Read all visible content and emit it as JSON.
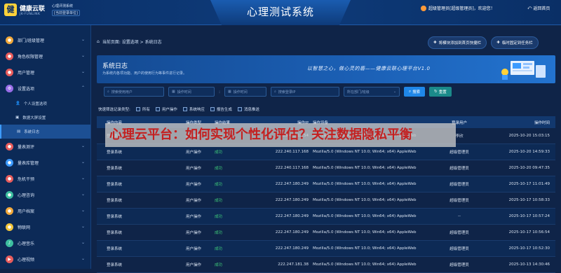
{
  "header": {
    "logo_mark": "健",
    "logo_cn": "健康云联",
    "logo_en": "JK-YUNLINK",
    "system_name": "心理评测系统",
    "unit_label": "[当前登录单位]",
    "app_title": "心理测试系统",
    "user_text": "超级管理员[超级管理员]，欢迎您！",
    "back_label": "返回首页"
  },
  "sidebar": {
    "items": [
      {
        "label": "部门/班级管理",
        "icon": "org-icon",
        "color": "#f2a93b"
      },
      {
        "label": "角色权限管理",
        "icon": "role-icon",
        "color": "#e85c5c"
      },
      {
        "label": "用户管理",
        "icon": "user-icon",
        "color": "#e85c5c"
      },
      {
        "label": "设置选项",
        "icon": "settings-icon",
        "color": "#9a6ee8"
      }
    ],
    "sub_items": [
      {
        "label": "个人设置选项"
      },
      {
        "label": "数据大屏设置"
      },
      {
        "label": "系统日志"
      }
    ],
    "more_items": [
      {
        "label": "量表测评",
        "icon": "test-icon",
        "color": "#e85c5c"
      },
      {
        "label": "量表库管理",
        "icon": "library-icon",
        "color": "#3d9bff"
      },
      {
        "label": "危机干预",
        "icon": "crisis-icon",
        "color": "#e85c5c"
      },
      {
        "label": "心理咨询",
        "icon": "consult-icon",
        "color": "#3dbfa0"
      },
      {
        "label": "用户档案",
        "icon": "archive-icon",
        "color": "#f2a93b"
      },
      {
        "label": "物联网",
        "icon": "iot-icon",
        "color": "#f2c53b"
      },
      {
        "label": "心理音乐",
        "icon": "music-icon",
        "color": "#3dbfa0"
      },
      {
        "label": "心理视频",
        "icon": "video-icon",
        "color": "#e85c5c"
      }
    ]
  },
  "breadcrumb": "当前页面: 设置选项 > 系统日志",
  "tools": {
    "add_shortcut": "将模块添加到首页快捷栏",
    "pin_sidebar": "临时固定到任务栏"
  },
  "banner": {
    "title": "系统日志",
    "desc": "为系统内各项功能、用户的使用行为等事件进行记录。",
    "slogan": "以智慧之心，做心灵的盾——健康云联心理平台V1.0"
  },
  "filters": {
    "user_placeholder": "搜索使用用户",
    "start_placeholder": "操作时间",
    "end_placeholder": "操作时间",
    "ip_placeholder": "搜索登录IP",
    "dept_placeholder": "所在部门/班级",
    "search_label": "搜索",
    "reset_label": "重置"
  },
  "quick": {
    "label": "快速筛选记录类型:",
    "options": [
      "所有",
      "用户操作",
      "系统响应",
      "报告生成",
      "消息推送"
    ]
  },
  "table": {
    "headers": [
      "操作内容",
      "操作类型",
      "操作结果",
      "操作IP",
      "操作设备",
      "",
      "登录用户",
      "操作时间"
    ],
    "rows": [
      [
        "登录系统",
        "用户操作",
        "成功",
        "123.4.101.154",
        "Mozilla/5.0 (Windows NT 10.0; Win64; x64) AppleWebKit/537.36 (KHTML, like Gec...",
        "",
        "李欣",
        "2025-10-20 15:03:15"
      ],
      [
        "登录系统",
        "用户操作",
        "成功",
        "222.240.117.168",
        "Mozilla/5.0 (Windows NT 10.0; Win64; x64) AppleWebKit/537.36 (KHTML, like Gec...",
        "",
        "超级管理员",
        "2025-10-20 14:59:33"
      ],
      [
        "登录系统",
        "用户操作",
        "成功",
        "222.240.117.168",
        "Mozilla/5.0 (Windows NT 10.0; Win64; x64) AppleWebKit/537.36 (KHTML, like Gec...",
        "",
        "超级管理员",
        "2025-10-20 09:47:35"
      ],
      [
        "登录系统",
        "用户操作",
        "成功",
        "222.247.180.249",
        "Mozilla/5.0 (Windows NT 10.0; Win64; x64) AppleWebKit/537.36 (KHTML, like Gec...",
        "",
        "超级管理员",
        "2025-10-17 11:01:49"
      ],
      [
        "登录系统",
        "用户操作",
        "成功",
        "222.247.180.249",
        "Mozilla/5.0 (Windows NT 10.0; Win64; x64) AppleWebKit/537.36 (KHTML, like Gec...",
        "",
        "超级管理员",
        "2025-10-17 10:58:33"
      ],
      [
        "登录系统",
        "用户操作",
        "成功",
        "222.247.180.249",
        "Mozilla/5.0 (Windows NT 10.0; Win64; x64) AppleWebKit/537.36 (KHTML, like Gec...",
        "",
        "--",
        "2025-10-17 10:57:24"
      ],
      [
        "登录系统",
        "用户操作",
        "成功",
        "222.247.180.249",
        "Mozilla/5.0 (Windows NT 10.0; Win64; x64) AppleWebKit/537.36 (KHTML, like Gec...",
        "",
        "超级管理员",
        "2025-10-17 10:56:54"
      ],
      [
        "登录系统",
        "用户操作",
        "成功",
        "222.247.180.249",
        "Mozilla/5.0 (Windows NT 10.0; Win64; x64) AppleWebKit/537.36 (KHTML, like Gec...",
        "",
        "超级管理员",
        "2025-10-17 10:52:30"
      ],
      [
        "登录系统",
        "用户操作",
        "成功",
        "222.247.181.38",
        "Mozilla/5.0 (Windows NT 10.0; Win64; x64) AppleWebKit/537.36 (KHTML, like Gec...",
        "",
        "超级管理员",
        "2025-10-13 14:30:46"
      ]
    ]
  },
  "overlay_caption": "心理云平台：如何实现个性化评估？关注数据隐私平衡"
}
